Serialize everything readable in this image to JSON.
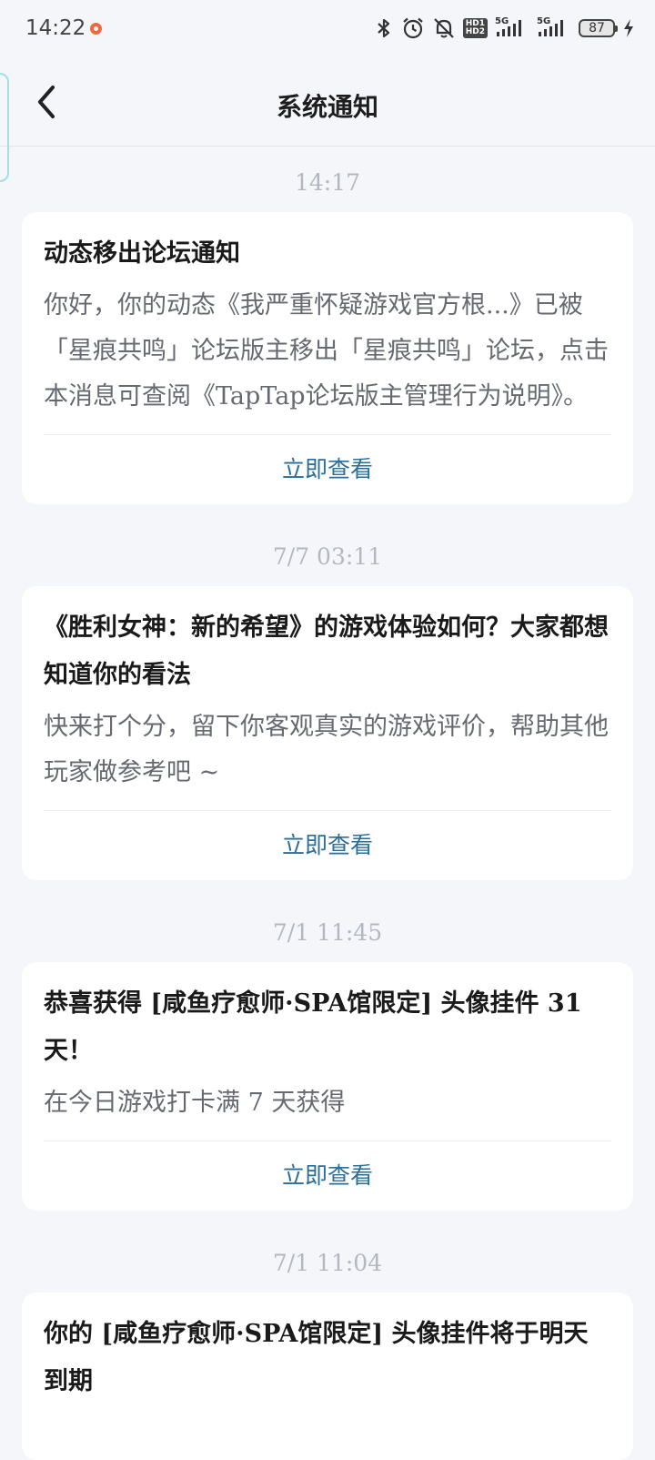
{
  "status_bar": {
    "time": "14:22",
    "battery": "87",
    "network_1": "5G",
    "network_2": "5G",
    "hd_badge_top": "HD1",
    "hd_badge_bottom": "HD2"
  },
  "header": {
    "title": "系统通知"
  },
  "messages": [
    {
      "timestamp": "14:17",
      "title": "动态移出论坛通知",
      "body": "你好，你的动态《我严重怀疑游戏官方根...》已被「星痕共鸣」论坛版主移出「星痕共鸣」论坛，点击本消息可查阅《TapTap论坛版主管理行为说明》。",
      "action": "立即查看"
    },
    {
      "timestamp": "7/7  03:11",
      "title": "《胜利女神：新的希望》的游戏体验如何？大家都想知道你的看法",
      "body": "快来打个分，留下你客观真实的游戏评价，帮助其他玩家做参考吧 ~",
      "action": "立即查看"
    },
    {
      "timestamp": "7/1  11:45",
      "title": "恭喜获得 [咸鱼疗愈师·SPA馆限定] 头像挂件 31 天！",
      "body": "在今日游戏打卡满 7 天获得",
      "action": "立即查看"
    },
    {
      "timestamp": "7/1  11:04",
      "title": "你的 [咸鱼疗愈师·SPA馆限定] 头像挂件将于明天到期"
    }
  ]
}
